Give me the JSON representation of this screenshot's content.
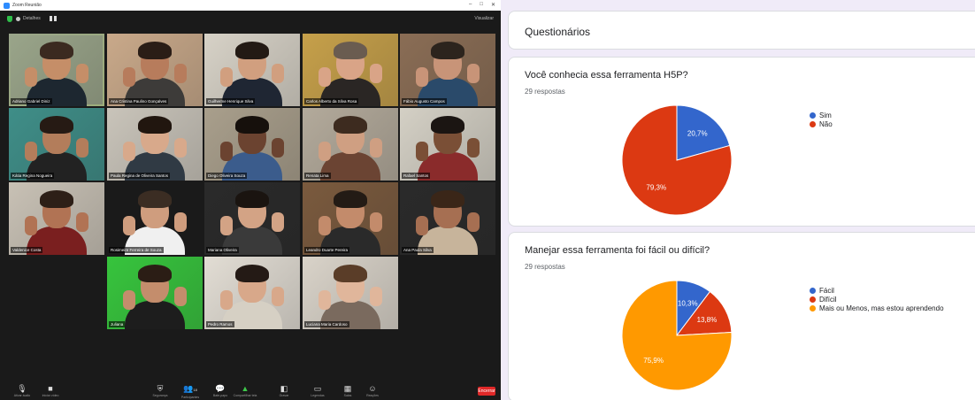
{
  "zoom": {
    "window_title": "Zoom Reunião",
    "window_controls": [
      "–",
      "□",
      "✕"
    ],
    "meeting_info": "Detalhes",
    "view_label": "Visualizar",
    "participants": [
      {
        "name": "Adriano Gabriel Diniz",
        "speaking": true
      },
      {
        "name": "Ana Cristina Paulino Gonçalves",
        "speaking": false
      },
      {
        "name": "Guilherme Henrique Silva",
        "speaking": false
      },
      {
        "name": "Carlos Alberto da Silva Rosa",
        "speaking": false
      },
      {
        "name": "Fábio Augusto Campos",
        "speaking": false
      },
      {
        "name": "Kátia Regina Nogueira",
        "speaking": false
      },
      {
        "name": "Paula Regina de Oliveira Santos",
        "speaking": false
      },
      {
        "name": "Diego Oliveira Souza",
        "speaking": false
      },
      {
        "name": "Renata Lima",
        "speaking": false
      },
      {
        "name": "Rafael Santos",
        "speaking": false
      },
      {
        "name": "Valdenice Costa",
        "speaking": false
      },
      {
        "name": "Rosimeire Ferreira de Souza",
        "speaking": false
      },
      {
        "name": "Mariana Oliveira",
        "speaking": false
      },
      {
        "name": "Leandro Duarte Pereira",
        "speaking": false
      },
      {
        "name": "Ana Paula Silva",
        "speaking": false
      },
      {
        "name": "Juliana",
        "speaking": false
      },
      {
        "name": "Pedro Ramos",
        "speaking": false
      },
      {
        "name": "Luciana Maria Cardoso",
        "speaking": false
      }
    ],
    "toolbar": {
      "mute": "Ativar áudio",
      "video": "Iniciar vídeo",
      "security": "Segurança",
      "participants": "Participantes",
      "participants_count": "18",
      "chat": "Bate-papo",
      "share": "Compartilhar tela",
      "record": "Gravar",
      "reactions": "Reações",
      "captions": "Legendas",
      "breakout": "Salas",
      "apps": "Aplicativos",
      "end": "Encerrar"
    }
  },
  "forms": {
    "header_title": "Questionários",
    "questions": [
      {
        "title": "Você conhecia essa ferramenta H5P?",
        "responses": "29 respostas"
      },
      {
        "title": "Manejar essa ferramenta foi fácil ou difícil?",
        "responses": "29 respostas"
      }
    ]
  },
  "chart_data": [
    {
      "type": "pie",
      "title": "Você conhecia essa ferramenta H5P?",
      "categories": [
        "Sim",
        "Não"
      ],
      "values": [
        20.7,
        79.3
      ],
      "labels": [
        "20,7%",
        "79,3%"
      ],
      "colors": [
        "#3366cc",
        "#dc3912"
      ],
      "legend": "right"
    },
    {
      "type": "pie",
      "title": "Manejar essa ferramenta foi fácil ou difícil?",
      "categories": [
        "Fácil",
        "Difícil",
        "Mais ou Menos, mas estou aprendendo"
      ],
      "values": [
        10.3,
        13.8,
        75.9
      ],
      "labels": [
        "10,3%",
        "13,8%",
        "75,9%"
      ],
      "colors": [
        "#3366cc",
        "#dc3912",
        "#ff9900"
      ],
      "legend": "right"
    }
  ]
}
